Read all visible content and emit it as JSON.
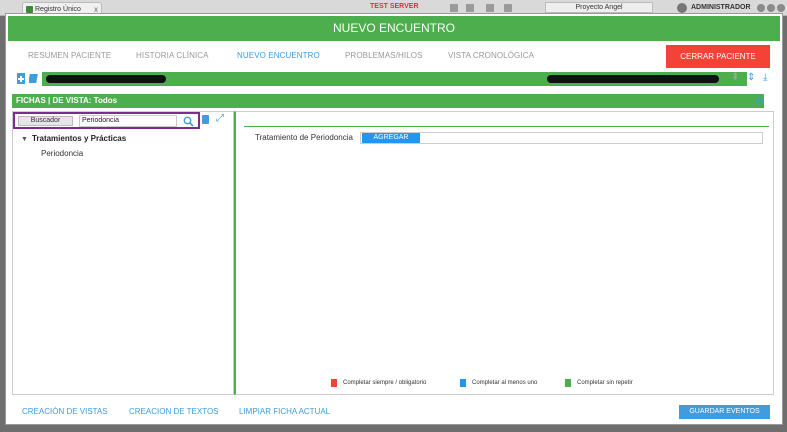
{
  "topbar": {
    "tab_label": "Registro Único",
    "tab_close": "x",
    "server_label": "TEST SERVER",
    "project": "Proyecto Angel",
    "user": "ADMINISTRADOR"
  },
  "window": {
    "title": "NUEVO ENCUENTRO"
  },
  "nav": {
    "items": [
      "RESUMEN PACIENTE",
      "HISTORIA CLÍNICA",
      "NUEVO ENCUENTRO",
      "PROBLEMAS/HILOS",
      "VISTA CRONOLÓGICA"
    ],
    "active_index": 2,
    "close_label": "CERRAR PACIENTE"
  },
  "fichas": {
    "header": "FICHAS | DE VISTA: Todos"
  },
  "search": {
    "button_label": "Buscador",
    "value": "Periodoncia"
  },
  "tree": {
    "group": "Tratamientos y Prácticas",
    "items": [
      "Periodoncia"
    ]
  },
  "form": {
    "row_label": "Tratamiento de Periodoncia",
    "add_label": "AGREGAR"
  },
  "legend": [
    {
      "label": "Completar siempre / obligatorio",
      "color": "#f44336"
    },
    {
      "label": "Completar al menos uno",
      "color": "#2196f3"
    },
    {
      "label": "Completar sin repetir",
      "color": "#4cae4c"
    }
  ],
  "footer": {
    "links": [
      "CREACIÓN DE VISTAS",
      "CREACION DE TEXTOS",
      "LIMPIAR FICHA ACTUAL"
    ],
    "save_label": "GUARDAR EVENTOS"
  },
  "colors": {
    "accent_green": "#4cae4c",
    "accent_blue": "#3e9cdf",
    "close_red": "#f44336"
  }
}
